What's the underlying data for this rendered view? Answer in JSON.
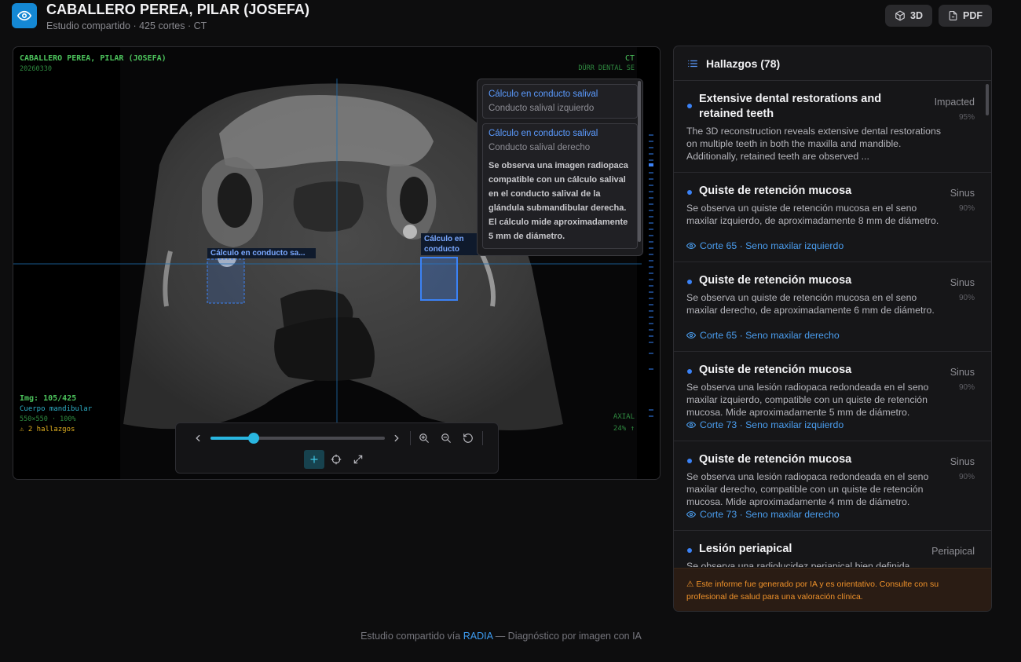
{
  "header": {
    "title": "CABALLERO PEREA, PILAR (JOSEFA)",
    "subtitle": "Estudio compartido · 425 cortes · CT",
    "btn_3d": "3D",
    "btn_pdf": "PDF"
  },
  "viewer": {
    "overlay": {
      "patient": "CABALLERO PEREA, PILAR (JOSEFA)",
      "date": "20260330",
      "modality": "CT",
      "device": "DÜRR DENTAL SE",
      "image_index": "Img: 105/425",
      "region": "Cuerpo mandibular",
      "size_zoom": "550×550 · 100%",
      "findings": "⚠ 2 hallazgos",
      "plane": "AXIAL",
      "position": "24% ↑"
    },
    "bboxes": [
      {
        "label": "Cálculo en conducto sa..."
      },
      {
        "label": "Cálculo en conducto salival"
      }
    ],
    "popup": {
      "cards": [
        {
          "title": "Cálculo en conducto salival",
          "subtitle": "Conducto salival izquierdo"
        },
        {
          "title": "Cálculo en conducto salival",
          "subtitle": "Conducto salival derecho",
          "description": "Se observa una imagen radiopaca compatible con un cálculo salival en el conducto salival de la glándula submandibular derecha. El cálculo mide aproximadamente 5 mm de diámetro."
        }
      ]
    },
    "slider": {
      "value": 0.247,
      "current": 105,
      "total": 425
    }
  },
  "findings_panel": {
    "title": "Hallazgos (78)",
    "items": [
      {
        "title": "Extensive dental restorations and retained teeth",
        "category": "Impacted",
        "confidence": "95%",
        "description": "The 3D reconstruction reveals extensive dental restorations on multiple teeth in both the maxilla and mandible. Additionally, retained teeth are observed ...",
        "link": ""
      },
      {
        "title": "Quiste de retención mucosa",
        "category": "Sinus",
        "confidence": "90%",
        "description": "Se observa un quiste de retención mucosa en el seno maxilar izquierdo, de aproximadamente 8 mm de diámetro.",
        "link": "Corte 65 · Seno maxilar izquierdo"
      },
      {
        "title": "Quiste de retención mucosa",
        "category": "Sinus",
        "confidence": "90%",
        "description": "Se observa un quiste de retención mucosa en el seno maxilar derecho, de aproximadamente 6 mm de diámetro.",
        "link": "Corte 65 · Seno maxilar derecho"
      },
      {
        "title": "Quiste de retención mucosa",
        "category": "Sinus",
        "confidence": "90%",
        "description": "Se observa una lesión radiopaca redondeada en el seno maxilar izquierdo, compatible con un quiste de retención mucosa. Mide aproximadamente 5 mm de diámetro.",
        "link": "Corte 73 · Seno maxilar izquierdo"
      },
      {
        "title": "Quiste de retención mucosa",
        "category": "Sinus",
        "confidence": "90%",
        "description": "Se observa una lesión radiopaca redondeada en el seno maxilar derecho, compatible con un quiste de retención mucosa. Mide aproximadamente 4 mm de diámetro.",
        "link": "Corte 73 · Seno maxilar derecho"
      },
      {
        "title": "Lesión periapical",
        "category": "Periapical",
        "confidence": "",
        "description": "Se observa una radiolucidez periapical bien definida",
        "link": ""
      }
    ],
    "disclaimer": "⚠ Este informe fue generado por IA y es orientativo. Consulte con su profesional de salud para una valoración clínica."
  },
  "footer": {
    "prefix": "Estudio compartido vía ",
    "brand": "RADIA",
    "suffix": " — Diagnóstico por imagen con IA"
  },
  "colors": {
    "accent": "#1488d4",
    "overlay_green": "#4cc35c",
    "link_blue": "#4a9dee",
    "finding_dot": "#3b82f6",
    "warning": "#f0922a"
  },
  "icons": [
    "eye-icon",
    "cube-icon",
    "file-pdf-icon",
    "list-icon",
    "chevron-left-icon",
    "chevron-right-icon",
    "zoom-in-icon",
    "zoom-out-icon",
    "reset-icon",
    "crosshair-plus-icon",
    "target-icon",
    "expand-icon"
  ]
}
